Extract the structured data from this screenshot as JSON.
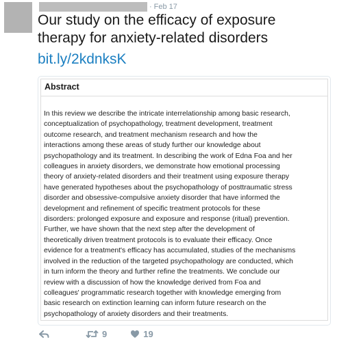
{
  "tweet": {
    "date": "Feb 17",
    "separator": "·",
    "text_lines": [
      "Our study on the efficacy of exposure",
      "therapy for anxiety-related disorders"
    ],
    "link": "bit.ly/2kdnksK"
  },
  "card": {
    "heading": "Abstract",
    "body_lines": [
      "In this review we describe the intricate interrelationship among basic research,",
      "conceptualization of psychopathology, treatment development, treatment",
      "outcome research, and treatment mechanism research and how the",
      "interactions among these areas of study further our knowledge about",
      "psychopathology and its treatment. In describing the work of Edna Foa and her",
      "colleagues in anxiety disorders, we demonstrate how emotional processing",
      "theory of anxiety-related disorders and their treatment using exposure therapy",
      "have generated hypotheses about the psychopathology of posttraumatic stress",
      "disorder and obsessive-compulsive anxiety disorder that have informed the",
      "development and refinement of specific treatment protocols for these",
      "disorders: prolonged exposure and exposure and response (ritual) prevention.",
      "Further, we have shown that the next step after the development of",
      "theoretically driven treatment protocols is to evaluate their efficacy. Once",
      "evidence for a treatment's efficacy has accumulated, studies of the mechanisms",
      "involved in the reduction of the targeted psychopathology are conducted, which",
      "in turn inform the theory and further refine the treatments. We conclude our",
      "review with a discussion of how the knowledge derived from Foa and",
      "colleagues' programmatic research together with knowledge emerging from",
      "basic research on extinction learning can inform future research on the",
      "psychopathology of anxiety disorders and their treatments."
    ]
  },
  "actions": {
    "retweet_count": "9",
    "like_count": "19"
  },
  "icons": {
    "reply": "reply-icon",
    "retweet": "retweet-icon",
    "like": "heart-icon"
  },
  "colors": {
    "link": "#1b7fc1",
    "muted": "#8899a6",
    "redaction": "#bdbdbd"
  }
}
